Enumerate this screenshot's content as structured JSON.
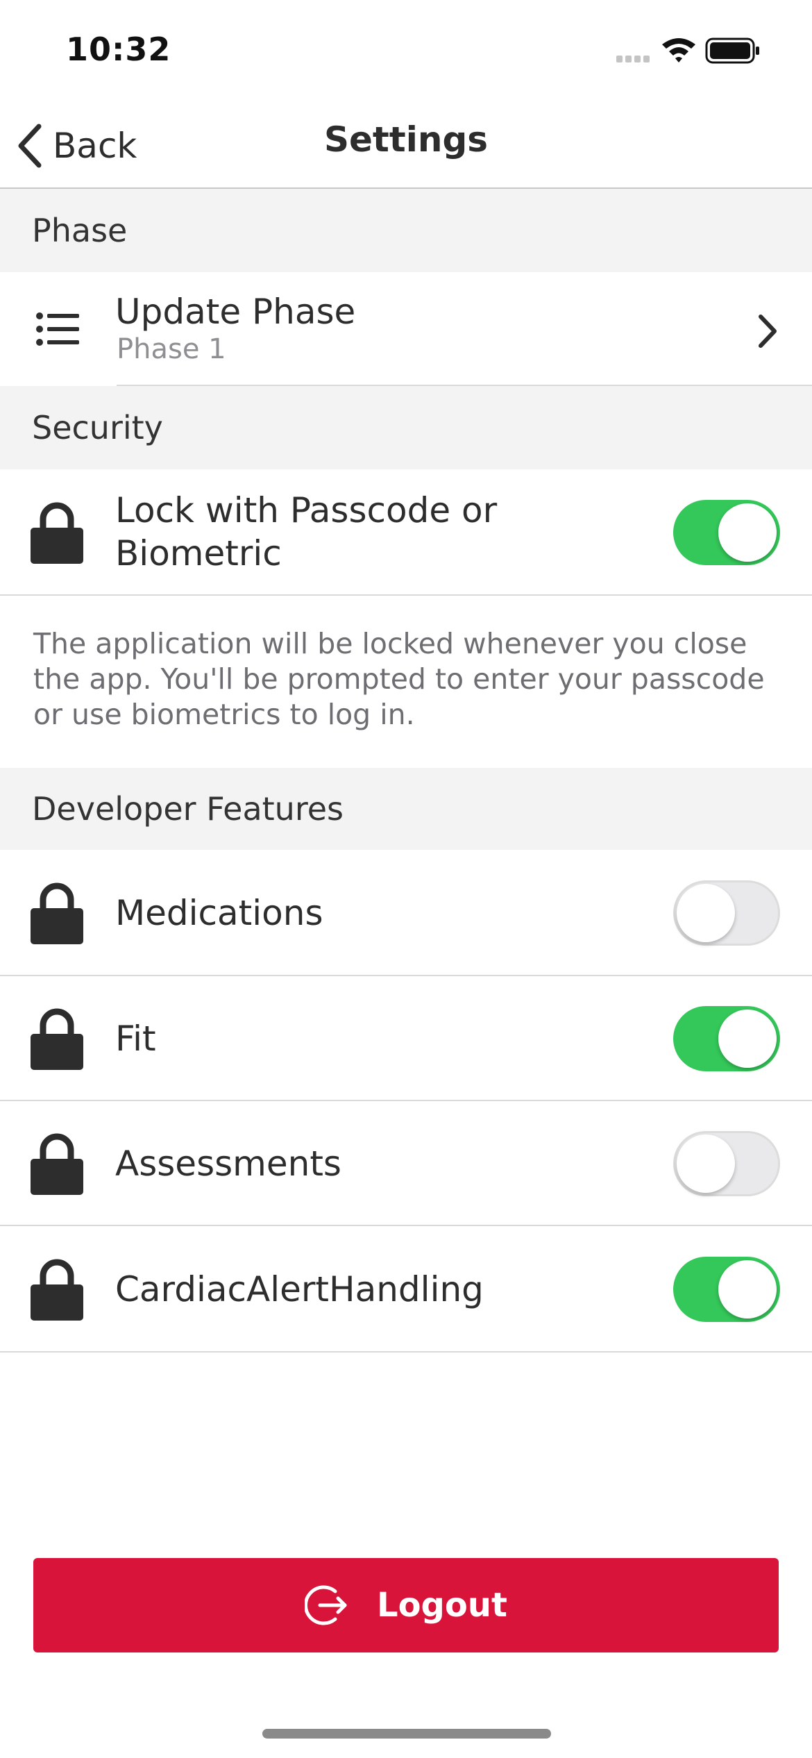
{
  "status_bar": {
    "time": "10:32"
  },
  "nav": {
    "back_label": "Back",
    "title": "Settings"
  },
  "sections": {
    "phase": {
      "header": "Phase",
      "row": {
        "title": "Update Phase",
        "subtitle": "Phase 1",
        "icon": "list-icon",
        "accessory": "chevron-right-icon"
      }
    },
    "security": {
      "header": "Security",
      "row": {
        "label": "Lock with Passcode or Biometric",
        "icon": "lock-icon",
        "enabled": true
      },
      "help_text": "The application will be locked whenever you close the app. You'll be prompted to enter your passcode or use biometrics to log in."
    },
    "developer": {
      "header": "Developer Features",
      "items": [
        {
          "label": "Medications",
          "icon": "lock-icon",
          "enabled": false
        },
        {
          "label": "Fit",
          "icon": "lock-icon",
          "enabled": true
        },
        {
          "label": "Assessments",
          "icon": "lock-icon",
          "enabled": false
        },
        {
          "label": "CardiacAlertHandling",
          "icon": "lock-icon",
          "enabled": true
        }
      ]
    }
  },
  "logout": {
    "label": "Logout",
    "icon": "logout-icon"
  },
  "colors": {
    "toggle_on": "#34c759",
    "toggle_off": "#e9e9eb",
    "logout_bg": "#d8143a",
    "section_bg": "#f3f3f3"
  }
}
